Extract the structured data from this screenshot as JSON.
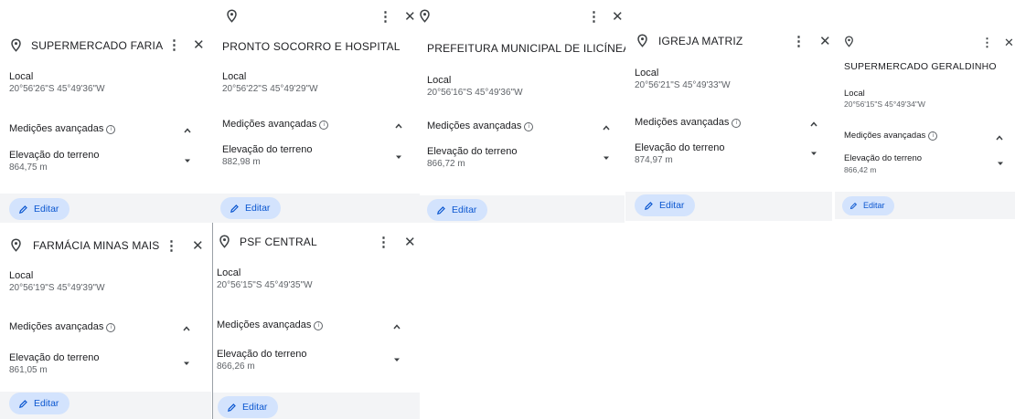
{
  "cards": [
    {
      "title": "SUPERMERCADO FARIA",
      "local_label": "Local",
      "coords": "20°56'26\"S 45°49'36\"W",
      "advanced_label": "Medições avançadas",
      "elev_label": "Elevação do terreno",
      "elev_value": "864,75 m",
      "edit_label": "Editar"
    },
    {
      "title": "PRONTO SOCORRO E HOSPITAL",
      "local_label": "Local",
      "coords": "20°56'22\"S 45°49'29\"W",
      "advanced_label": "Medições avançadas",
      "elev_label": "Elevação do terreno",
      "elev_value": "882,98 m",
      "edit_label": "Editar"
    },
    {
      "title": "PREFEITURA MUNICIPAL DE ILICÍNEA",
      "local_label": "Local",
      "coords": "20°56'16\"S 45°49'36\"W",
      "advanced_label": "Medições avançadas",
      "elev_label": "Elevação do terreno",
      "elev_value": "866,72 m",
      "edit_label": "Editar"
    },
    {
      "title": "IGREJA MATRIZ",
      "local_label": "Local",
      "coords": "20°56'21\"S 45°49'33\"W",
      "advanced_label": "Medições avançadas",
      "elev_label": "Elevação do terreno",
      "elev_value": "874,97 m",
      "edit_label": "Editar"
    },
    {
      "title": "SUPERMERCADO GERALDINHO",
      "local_label": "Local",
      "coords": "20°56'15\"S 45°49'34\"W",
      "advanced_label": "Medições avançadas",
      "elev_label": "Elevação do terreno",
      "elev_value": "866,42 m",
      "edit_label": "Editar"
    },
    {
      "title": "FARMÁCIA MINAS MAIS",
      "local_label": "Local",
      "coords": "20°56'19\"S 45°49'39\"W",
      "advanced_label": "Medições avançadas",
      "elev_label": "Elevação do terreno",
      "elev_value": "861,05 m",
      "edit_label": "Editar"
    },
    {
      "title": "PSF CENTRAL",
      "local_label": "Local",
      "coords": "20°56'15\"S 45°49'35\"W",
      "advanced_label": "Medições avançadas",
      "elev_label": "Elevação do terreno",
      "elev_value": "866,26 m",
      "edit_label": "Editar"
    }
  ],
  "icons": {
    "pin": "map-pin-icon",
    "more": "more-vert-icon",
    "close": "close-icon",
    "info": "info-icon",
    "expand_less": "chevron-up-icon",
    "dropdown": "dropdown-arrow-icon",
    "edit": "pencil-icon"
  },
  "colors": {
    "edit_button_bg": "#d3e3fd",
    "edit_button_text": "#0b57d0",
    "footer_bg": "#f3f4f6"
  }
}
